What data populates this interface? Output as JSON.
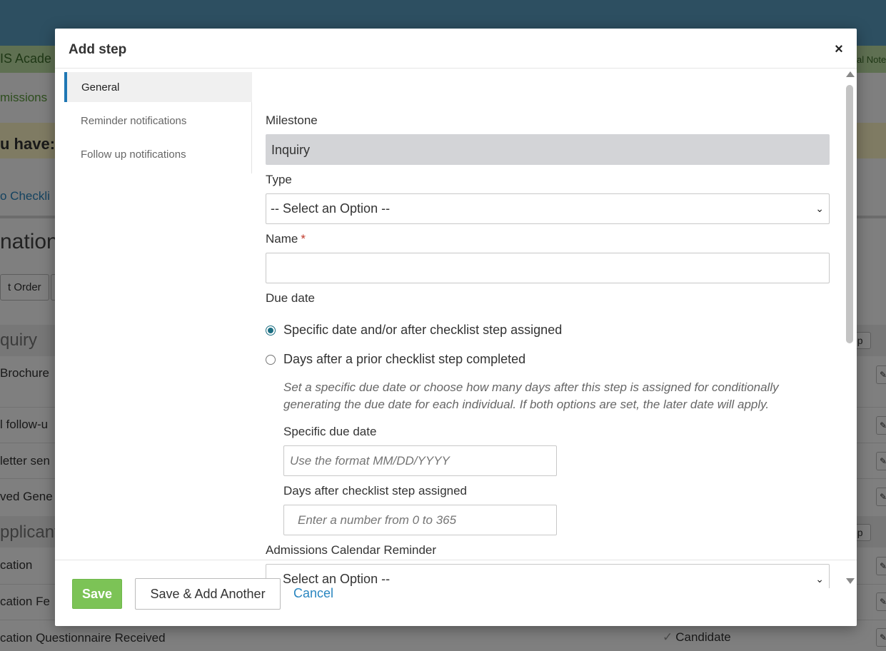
{
  "background": {
    "school_name": "IS Acade",
    "right_note": "al Note",
    "nav_admissions": "missions",
    "alert_text": "u have:",
    "checklist_link": "o Checkli",
    "page_heading": "national",
    "order_button": "t Order",
    "sections": [
      "quiry",
      "pplicant"
    ],
    "rows": [
      "Brochure",
      "l follow-u",
      "letter sen",
      "ved Gene",
      "cation",
      "cation Fe",
      "cation Questionnaire Received"
    ],
    "step_button": "ep",
    "candidate_label": "Candidate"
  },
  "modal": {
    "title": "Add step",
    "close_icon": "×"
  },
  "tabs": [
    {
      "label": "General",
      "active": true
    },
    {
      "label": "Reminder notifications",
      "active": false
    },
    {
      "label": "Follow up notifications",
      "active": false
    }
  ],
  "form": {
    "milestone": {
      "label": "Milestone",
      "value": "Inquiry"
    },
    "type": {
      "label": "Type",
      "value": "-- Select an Option --"
    },
    "name": {
      "label": "Name",
      "required_marker": "*",
      "value": ""
    },
    "due_date": {
      "label": "Due date",
      "options": [
        {
          "label": "Specific date and/or after checklist step assigned",
          "checked": true
        },
        {
          "label": "Days after a prior checklist step completed",
          "checked": false
        }
      ],
      "help_text": "Set a specific due date or choose how many days after this step is assigned for conditionally generating the due date for each individual. If both options are set, the later date will apply.",
      "specific_due_date": {
        "label": "Specific due date",
        "placeholder": "Use the format MM/DD/YYYY"
      },
      "days_after": {
        "label": "Days after checklist step assigned",
        "placeholder": "Enter a number from 0 to 365"
      }
    },
    "calendar_reminder": {
      "label": "Admissions Calendar Reminder",
      "value": "-- Select an Option --"
    }
  },
  "footer": {
    "save_label": "Save",
    "save_add_label": "Save & Add Another",
    "cancel_label": "Cancel"
  },
  "colors": {
    "accent_blue": "#1f77b4",
    "save_green": "#7cc356",
    "link_blue": "#2a86c0"
  }
}
